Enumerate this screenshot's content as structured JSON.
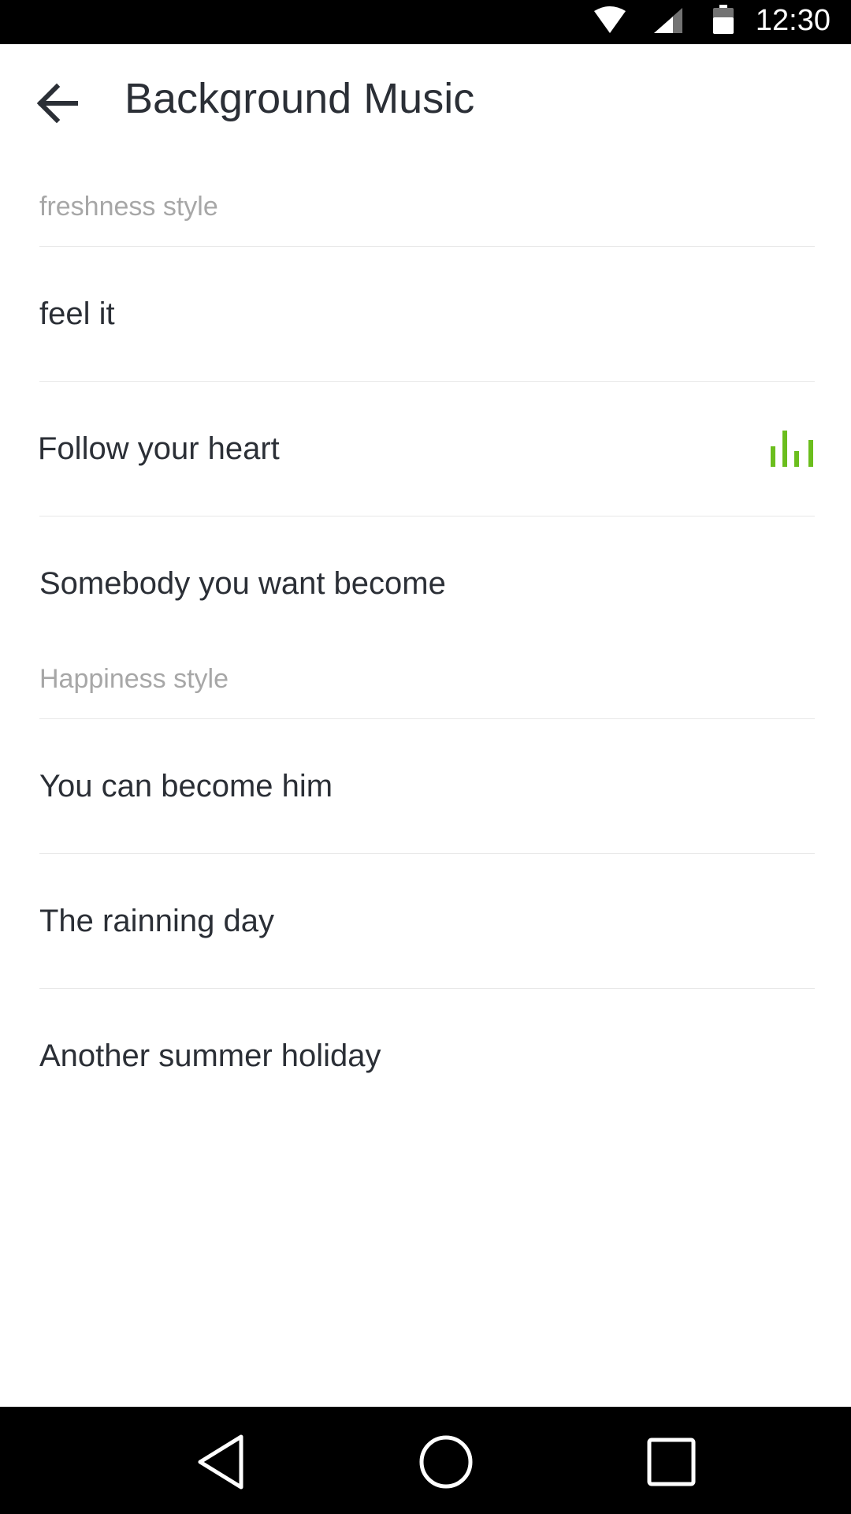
{
  "status_bar": {
    "time": "12:30",
    "icons": [
      "wifi-icon",
      "signal-icon",
      "battery-icon"
    ]
  },
  "toolbar": {
    "title": "Background Music",
    "back_icon": "arrow-left-icon"
  },
  "sections": [
    {
      "header": "freshness style",
      "items": [
        {
          "title": "feel it",
          "playing": false
        },
        {
          "title": "Follow your heart",
          "playing": true
        },
        {
          "title": "Somebody you want become",
          "playing": false
        }
      ]
    },
    {
      "header": "Happiness style",
      "items": [
        {
          "title": "You can become him",
          "playing": false
        },
        {
          "title": "The rainning day",
          "playing": false
        },
        {
          "title": "Another summer holiday",
          "playing": false
        }
      ]
    }
  ],
  "nav_bar": {
    "icons": [
      "nav-back-icon",
      "nav-home-icon",
      "nav-recents-icon"
    ]
  },
  "colors": {
    "accent": "#6bbe1d",
    "text_primary": "#2b2f36",
    "text_secondary": "#a7a7a7",
    "divider": "#e8e8e8",
    "system_bar": "#000000"
  }
}
